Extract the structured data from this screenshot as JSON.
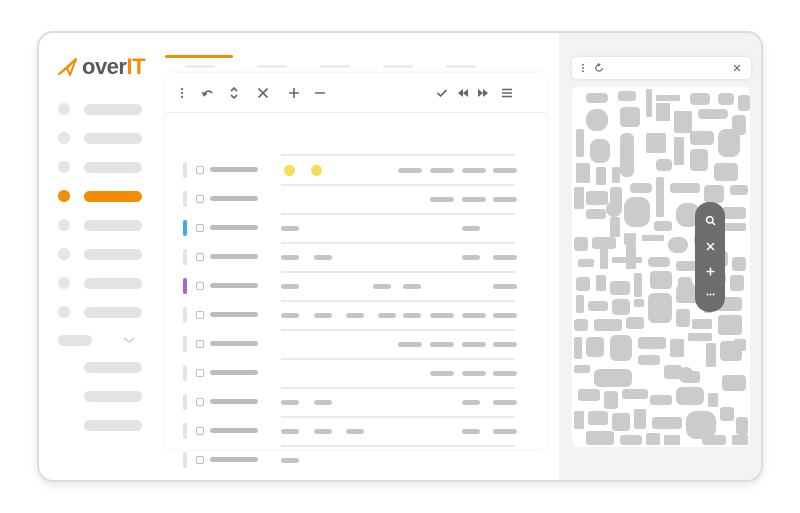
{
  "app": {
    "logo_text": "over",
    "logo_accent": "IT",
    "brand_color": "#f28c00"
  },
  "sidebar": {
    "active_index": 4,
    "icons": [
      "dot-icon",
      "chevron-down-icon"
    ]
  },
  "toolbar": {
    "items": [
      "more-vert-icon",
      "undo-icon",
      "sort-icon",
      "close-icon",
      "add-icon",
      "remove-icon",
      "check-icon",
      "rewind-icon",
      "fast-forward-icon",
      "menu-icon"
    ]
  },
  "list": {
    "row_count": 11,
    "accent_rows": {
      "2": "#3aaee0",
      "4": "#a267d0"
    },
    "marker_color": "#f7dc5c"
  },
  "map": {
    "search_icons": [
      "more-vert-icon",
      "refresh-icon",
      "close-icon"
    ],
    "controls": [
      "search-icon",
      "close-icon",
      "add-icon",
      "more-horiz-icon"
    ]
  }
}
